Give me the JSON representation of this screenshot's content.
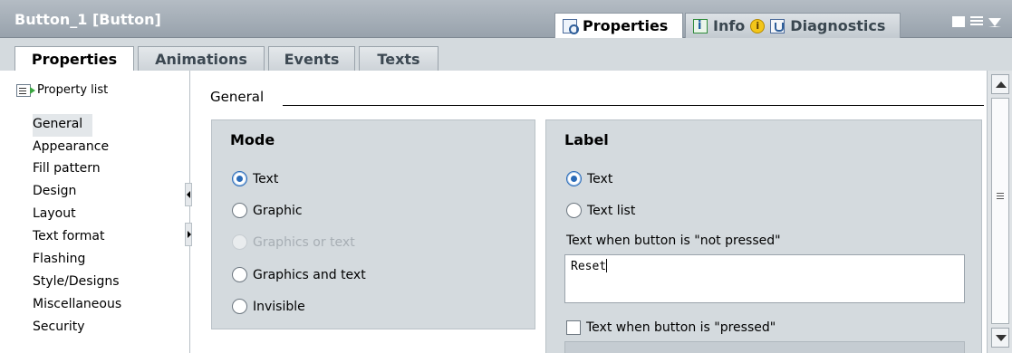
{
  "window": {
    "title": "Button_1 [Button]",
    "top_tabs": [
      {
        "label": "Properties",
        "icon": "properties-icon",
        "active": true
      },
      {
        "label": "Info",
        "icon": "info-icon",
        "badge": "i",
        "active": false
      },
      {
        "label": "Diagnostics",
        "icon": "diagnostics-icon",
        "active": false
      }
    ]
  },
  "subtabs": [
    {
      "label": "Properties",
      "active": true
    },
    {
      "label": "Animations",
      "active": false
    },
    {
      "label": "Events",
      "active": false
    },
    {
      "label": "Texts",
      "active": false
    }
  ],
  "sidebar": {
    "property_list_label": "Property list",
    "items": [
      {
        "label": "General",
        "selected": true
      },
      {
        "label": "Appearance"
      },
      {
        "label": "Fill pattern"
      },
      {
        "label": "Design"
      },
      {
        "label": "Layout"
      },
      {
        "label": "Text format"
      },
      {
        "label": "Flashing"
      },
      {
        "label": "Style/Designs"
      },
      {
        "label": "Miscellaneous"
      },
      {
        "label": "Security"
      }
    ]
  },
  "main": {
    "section_title": "General",
    "mode": {
      "title": "Mode",
      "options": [
        {
          "label": "Text",
          "checked": true,
          "disabled": false
        },
        {
          "label": "Graphic",
          "checked": false,
          "disabled": false
        },
        {
          "label": "Graphics or text",
          "checked": false,
          "disabled": true
        },
        {
          "label": "Graphics and text",
          "checked": false,
          "disabled": false
        },
        {
          "label": "Invisible",
          "checked": false,
          "disabled": false
        }
      ]
    },
    "label_group": {
      "title": "Label",
      "options": [
        {
          "label": "Text",
          "checked": true
        },
        {
          "label": "Text list",
          "checked": false
        }
      ],
      "not_pressed_label": "Text when button is \"not pressed\"",
      "not_pressed_value": "Reset",
      "pressed_checkbox_label": "Text when button is \"pressed\"",
      "pressed_checked": false
    }
  },
  "colors": {
    "titlebar": "#a5aeb7",
    "panel_bg": "#d4dade",
    "radio_accent": "#2a6bb8",
    "info_badge": "#f3c61a"
  }
}
